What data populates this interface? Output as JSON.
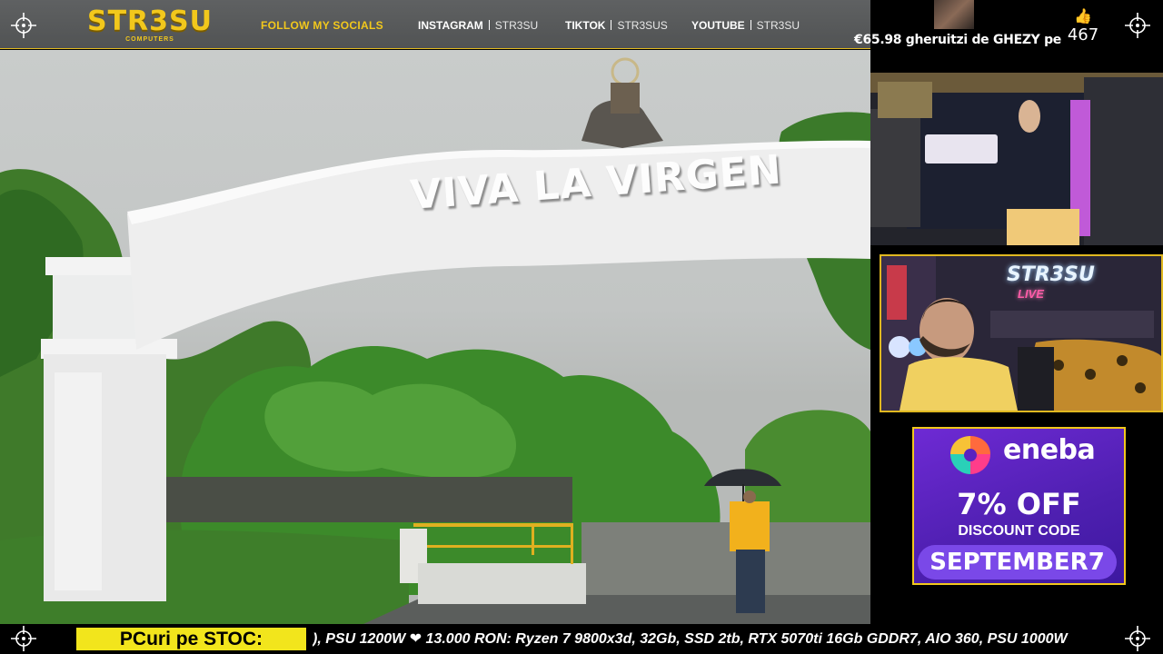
{
  "header": {
    "logo_text": "STR3SU",
    "logo_subtext": "COMPUTERS",
    "socials_heading": "FOLLOW MY SOCIALS",
    "socials": [
      {
        "network": "INSTAGRAM",
        "handle": "STR3SU"
      },
      {
        "network": "TIKTOK",
        "handle": "STR3SUS"
      },
      {
        "network": "YOUTUBE",
        "handle": "STR3SU"
      }
    ]
  },
  "video": {
    "arch_text": "VIVA LA VIRGEN"
  },
  "alert": {
    "message": "€65.98 gheruitzi de GHEZY pe",
    "like_count": "467"
  },
  "webcam": {
    "sign_text": "STR3SU",
    "sign_subtext": "LIVE"
  },
  "ad": {
    "brand": "eneba",
    "headline": "7% OFF",
    "subline": "DISCOUNT CODE",
    "code": "SEPTEMBER7"
  },
  "ticker": {
    "label": "PCuri pe STOC:",
    "text": "), PSU 1200W ❤ 13.000 RON: Ryzen 7 9800x3d, 32Gb, SSD 2tb, RTX 5070ti 16Gb GDDR7, AIO 360, PSU 1000W"
  },
  "colors": {
    "accent_yellow": "#f2c81c",
    "ticker_yellow": "#f2e51c",
    "eneba_purple": "#5a22c0",
    "topbar_gray": "#58595a"
  },
  "icons": [
    "crosshair-icon",
    "thumbs-up-icon",
    "eneba-logo-icon"
  ]
}
